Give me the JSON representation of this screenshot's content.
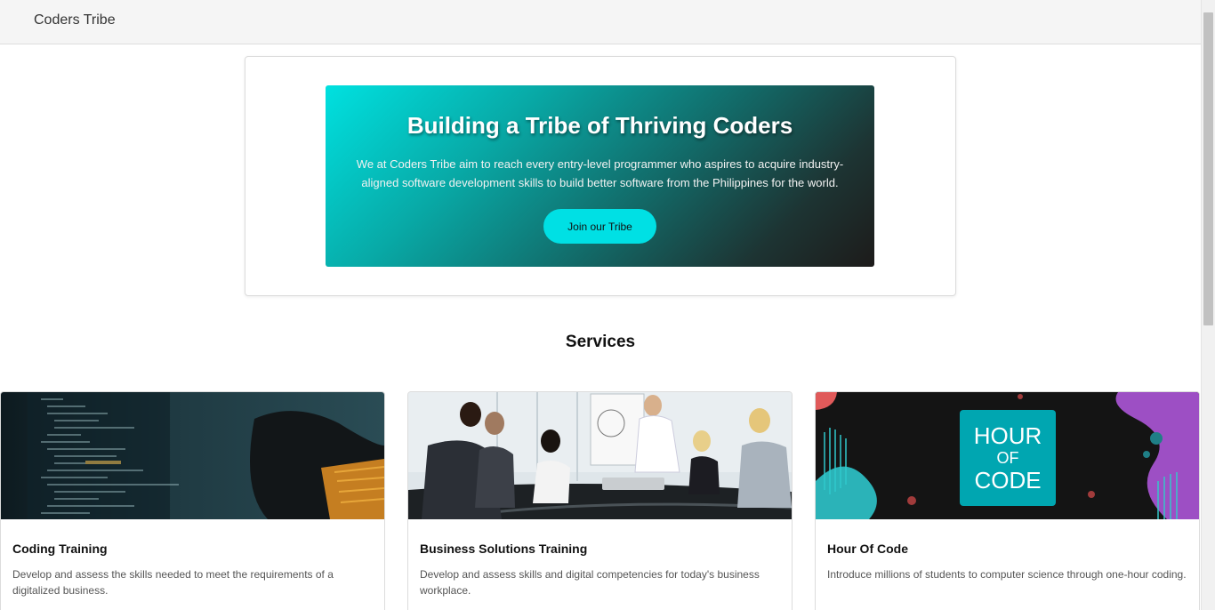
{
  "navbar": {
    "brand": "Coders Tribe"
  },
  "hero": {
    "title": "Building a Tribe of Thriving Coders",
    "description": "We at Coders Tribe aim to reach every entry-level programmer who aspires to acquire industry-aligned software development skills to build better software from the Philippines for the world.",
    "button_label": "Join our Tribe"
  },
  "services": {
    "heading": "Services",
    "items": [
      {
        "title": "Coding Training",
        "description": "Develop and assess the skills needed to meet the requirements of a digitalized business."
      },
      {
        "title": "Business Solutions Training",
        "description": "Develop and assess skills and digital competencies for today's business workplace."
      },
      {
        "title": "Hour Of Code",
        "description": "Introduce millions of students to computer science through one-hour coding.",
        "image_text": {
          "line1": "HOUR",
          "line2": "OF",
          "line3": "CODE"
        }
      }
    ]
  },
  "colors": {
    "accent": "#00e0e4",
    "hero_gradient_start": "#00e1e0",
    "hero_gradient_end": "#1d1b1a",
    "navbar_bg": "#f5f5f5"
  }
}
